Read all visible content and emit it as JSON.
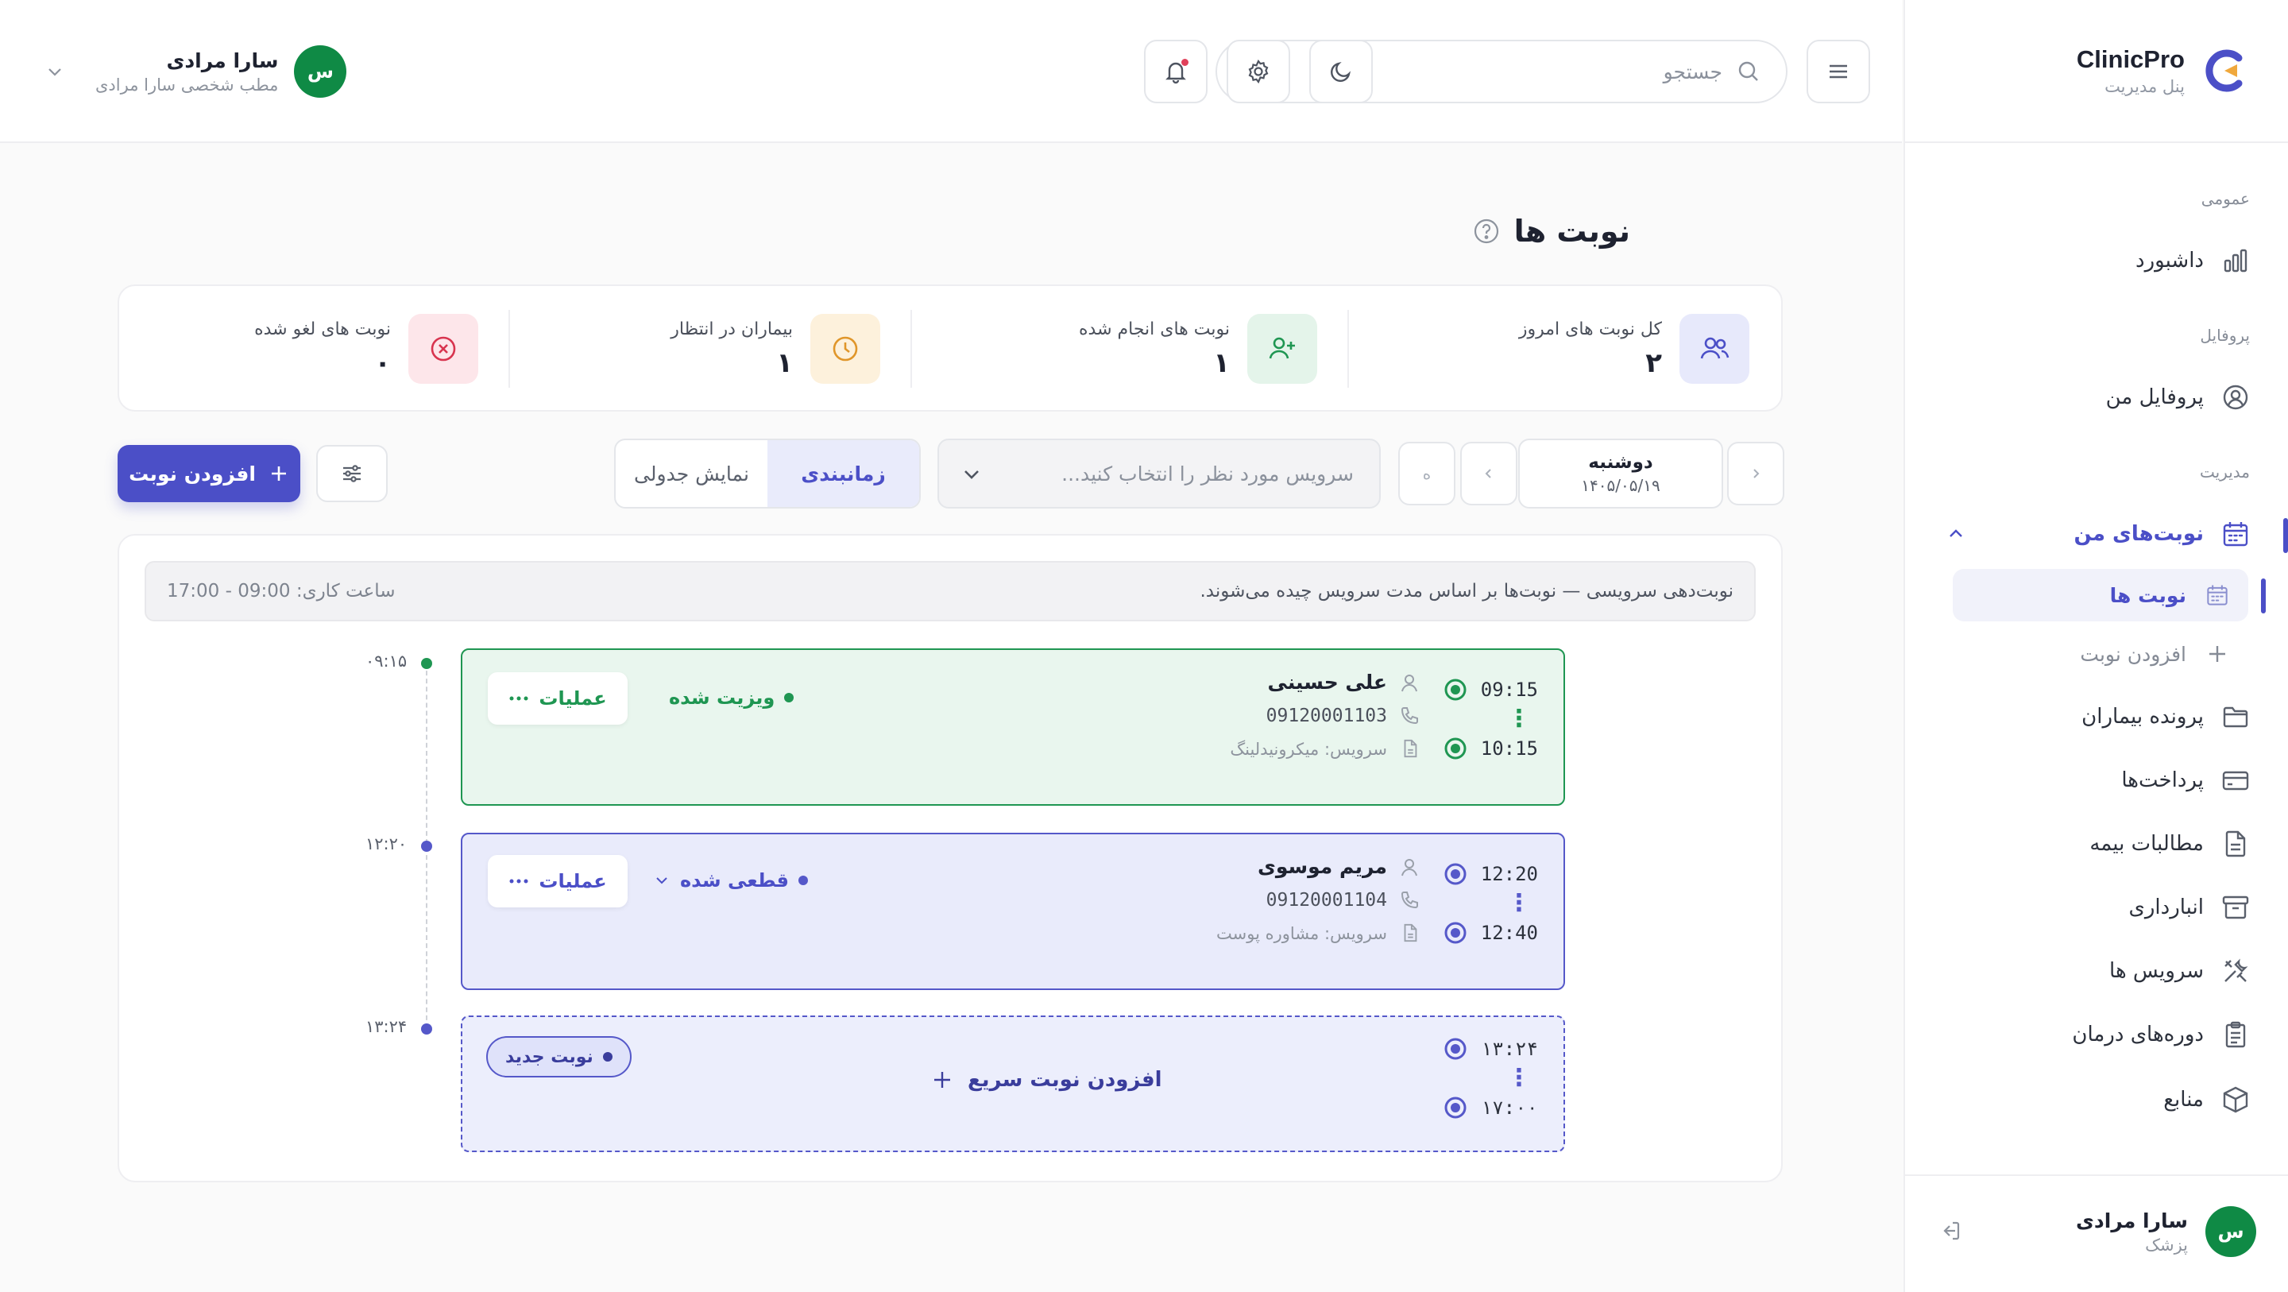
{
  "brand": {
    "name": "ClinicPro",
    "subtitle": "پنل مدیریت"
  },
  "sidebar": {
    "sections": {
      "general": "عمومی",
      "profile": "پروفایل",
      "management": "مدیریت"
    },
    "items": {
      "dashboard": "داشبورد",
      "my_profile": "پروفایل من",
      "my_appointments": "نوبت‌های من",
      "appointments": "نوبت ها",
      "add_appointment": "افزودن نوبت",
      "patient_files": "پرونده بیماران",
      "payments": "پرداخت‌ها",
      "insurance_claims": "مطالبات بیمه",
      "inventory": "انبارداری",
      "services": "سرویس ها",
      "treatment_courses": "دوره‌های درمان",
      "resources": "منابع"
    },
    "user": {
      "name": "سارا مرادی",
      "role": "پزشک",
      "initial": "س"
    }
  },
  "topbar": {
    "search_placeholder": "جستجو",
    "user": {
      "name": "سارا مرادی",
      "subtitle": "مطب شخصی سارا مرادی",
      "initial": "س"
    }
  },
  "page": {
    "title": "نوبت ها"
  },
  "stats": [
    {
      "label": "کل نوبت های امروز",
      "value": "۲"
    },
    {
      "label": "نوبت های انجام شده",
      "value": "۱"
    },
    {
      "label": "بیماران در انتظار",
      "value": "۱"
    },
    {
      "label": "نوبت های لغو شده",
      "value": "۰"
    }
  ],
  "toolbar": {
    "add_button": "افزودن نوبت",
    "view_table": "نمایش جدولی",
    "view_schedule": "زمانبندی",
    "service_placeholder": "سرویس مورد نظر را انتخاب کنید...",
    "today_short": "ه",
    "date_day": "دوشنبه",
    "date_value": "۱۴۰۵/۰۵/۱۹"
  },
  "schedule": {
    "info_text": "نوبت‌دهی سرویسی — نوبت‌ها بر اساس مدت سرویس چیده می‌شوند.",
    "work_hours": "ساعت کاری: 09:00 - 17:00",
    "timeline_labels": [
      "۰۹:۱۵",
      "۱۲:۲۰",
      "۱۳:۲۴"
    ],
    "appointments": [
      {
        "start": "09:15",
        "end": "10:15",
        "patient": "علی حسینی",
        "phone": "09120001103",
        "service": "سرویس: میکرونیدلینگ",
        "status": "ویزیت شده",
        "actions": "عملیات",
        "color": "#1f9652"
      },
      {
        "start": "12:20",
        "end": "12:40",
        "patient": "مریم موسوی",
        "phone": "09120001104",
        "service": "سرویس: مشاوره پوست",
        "status": "قطعی شده",
        "actions": "عملیات",
        "color": "#5558c9"
      }
    ],
    "new_slot": {
      "start": "۱۳:۲۴",
      "end": "۱۷:۰۰",
      "badge": "نوبت جدید",
      "quick_add": "افزودن نوبت سریع"
    }
  }
}
